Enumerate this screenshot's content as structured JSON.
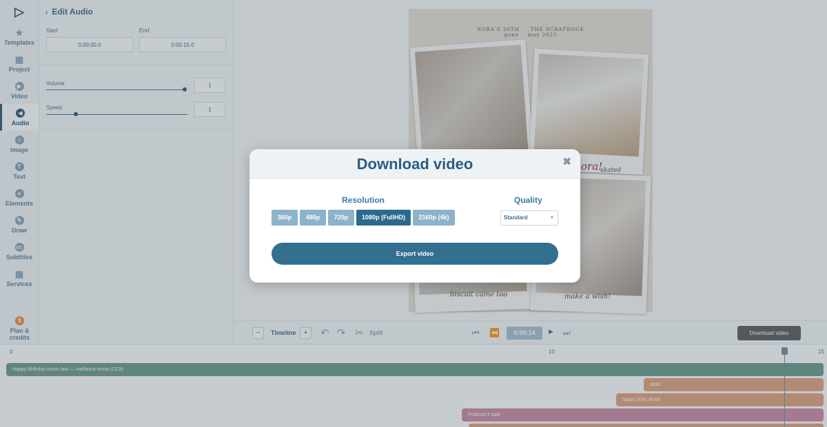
{
  "sidebar": {
    "items": [
      {
        "label": "Templates",
        "icon": "star-icon"
      },
      {
        "label": "Project",
        "icon": "grid-icon"
      },
      {
        "label": "Video",
        "icon": "play-icon"
      },
      {
        "label": "Audio",
        "icon": "audio-icon"
      },
      {
        "label": "Image",
        "icon": "image-icon"
      },
      {
        "label": "Text",
        "icon": "text-icon"
      },
      {
        "label": "Elements",
        "icon": "elements-icon"
      },
      {
        "label": "Draw",
        "icon": "pencil-icon"
      },
      {
        "label": "Subtitles",
        "icon": "subtitles-icon"
      },
      {
        "label": "Services",
        "icon": "grid-icon"
      }
    ],
    "active": "Audio",
    "plan_label": "Plan & credits"
  },
  "panel": {
    "title": "Edit Audio",
    "start_label": "Start",
    "start_value": "0:00:00.0",
    "end_label": "End",
    "end_value": "0:00:15.0",
    "volume_label": "Volume",
    "volume_value": "1",
    "speed_label": "Speed",
    "speed_value": "1"
  },
  "preview": {
    "header_left": "NORA'S 30TH",
    "header_right": "THE SCRAPBOOK",
    "sub_left": "gone",
    "sub_right": "may 2025",
    "overlay_text": "ora!",
    "overlay_text_2": "skated",
    "caption_left": "biscuit came too",
    "caption_right": "make a wish!"
  },
  "toolbar": {
    "minus": "−",
    "timeline_label": "Timeline",
    "plus": "+",
    "split_label": "Split",
    "time": "0:00:14",
    "download_label": "Download video"
  },
  "timeline": {
    "ruler": [
      "0",
      "10",
      "15"
    ],
    "clips": [
      {
        "label": "Happy Birthday music box — mellanna mona (CC0)",
        "color": "#6a9b8a"
      },
      {
        "label": "aaaa",
        "color": "#e0a37c"
      },
      {
        "label": "happy 30th, Nora!",
        "color": "#e0a37c"
      },
      {
        "label": "Polaroid 4 tape",
        "color": "#cc8aa2"
      }
    ]
  },
  "modal": {
    "title": "Download video",
    "close": "✖",
    "resolution_label": "Resolution",
    "quality_label": "Quality",
    "resolutions": [
      "360p",
      "480p",
      "720p",
      "1080p (FullHD)",
      "2160p (4k)"
    ],
    "selected_resolution": "1080p (FullHD)",
    "quality_value": "Standard",
    "export_label": "Export video"
  },
  "colors": {
    "accent": "#2b6a8f",
    "title": "#2b5d80",
    "export": "#336f91"
  }
}
